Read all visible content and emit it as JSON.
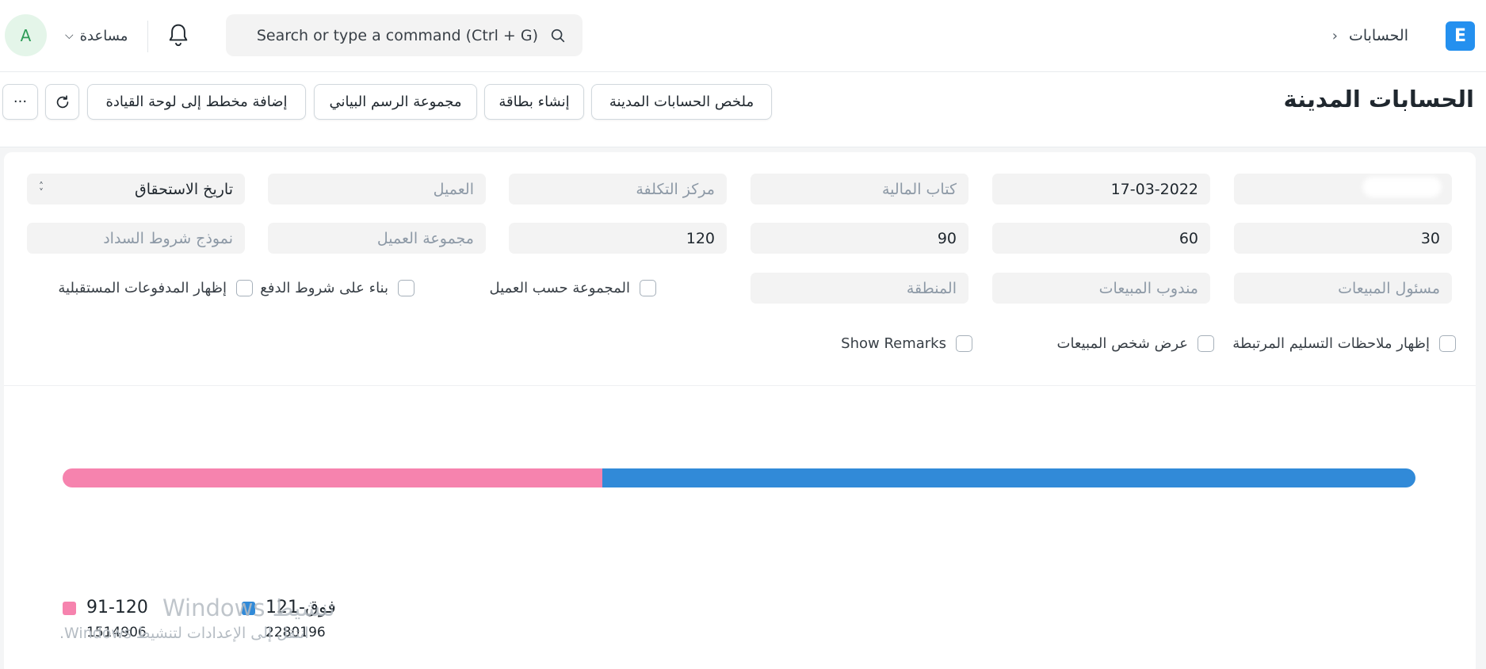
{
  "navbar": {
    "avatar_initial": "A",
    "help_label": "مساعدة",
    "search_placeholder": "Search or type a command (Ctrl + G)",
    "breadcrumb": "الحسابات",
    "logo_letter": "E"
  },
  "page": {
    "title": "الحسابات المدينة",
    "buttons": {
      "summary": "ملخص الحسابات المدينة",
      "create_card": "إنشاء بطاقة",
      "chart_group": "مجموعة الرسم البياني",
      "add_chart": "إضافة مخطط إلى لوحة القيادة",
      "more": "···"
    }
  },
  "filters": {
    "date": "17-03-2022",
    "finance_book": "كتاب المالية",
    "cost_center": "مركز التكلفة",
    "customer": "العميل",
    "ageing_based_on": "تاريخ الاستحقاق",
    "range1": "30",
    "range2": "60",
    "range3": "90",
    "range4": "120",
    "customer_group": "مجموعة العميل",
    "payment_terms_template": "نموذج شروط السداد",
    "sales_partner": "مسئول المبيعات",
    "sales_person": "مندوب المبيعات",
    "territory": "المنطقة",
    "group_by_customer": "المجموعة حسب العميل",
    "based_on_payment_terms": "بناء على شروط الدفع",
    "show_future_payments": "إظهار المدفوعات المستقبلية",
    "show_delivery_notes": "إظهار ملاحظات التسليم المرتبطة",
    "show_sales_person": "عرض شخص المبيعات",
    "show_remarks": "Show Remarks"
  },
  "chart_data": {
    "type": "bar",
    "stacked": true,
    "orientation": "horizontal",
    "series": [
      {
        "name": "91-120",
        "value": 1514906,
        "color": "#f683ae"
      },
      {
        "name": "فوق-121",
        "value": 2280196,
        "color": "#318ad8"
      }
    ],
    "legend_placement": "bottom-left"
  },
  "overlay": {
    "watermark_line1": "Windows تنشيط",
    "watermark_line2": "انتقل إلى الإعدادات لتنشيط Windows."
  }
}
